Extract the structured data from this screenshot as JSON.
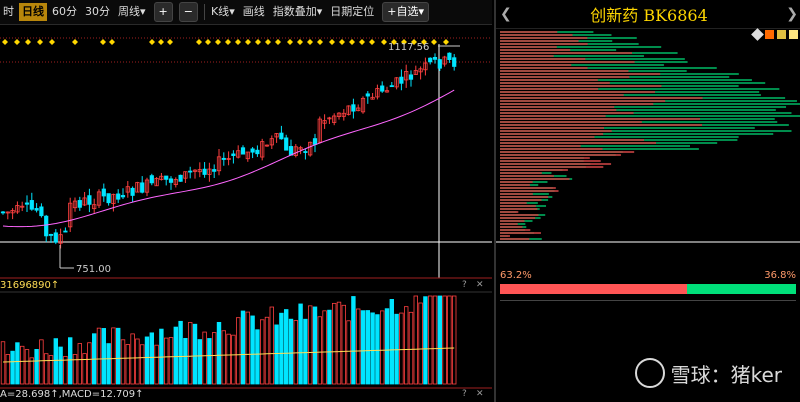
{
  "toolbar": {
    "items": [
      "时",
      "日线",
      "60分",
      "30分",
      "周线"
    ],
    "active_index": 1,
    "period_dropdown_caret": "▾",
    "plus": "+",
    "minus": "−",
    "kline": "K线",
    "draw": "画线",
    "indicator": "指数叠加",
    "date_locate": "日期定位",
    "watchlist": "+自选"
  },
  "panel": {
    "title": "创新药",
    "code": "BK6864",
    "nav_left": "❮",
    "nav_right": "❯",
    "pct_left": "63.2%",
    "pct_right": "36.8%",
    "buy_ratio": 0.632
  },
  "chart": {
    "high_label": "1117.56",
    "low_label": "751.00"
  },
  "volume": {
    "label": "31696890↑"
  },
  "macd": {
    "label": "A=28.698↑,MACD=12.709↑"
  },
  "watermark": {
    "text": "雪球：猪ker"
  },
  "colors": {
    "up": "#ff4040",
    "down": "#00e5ff",
    "ma": "#ff66ff",
    "accent": "#ffd700",
    "buy": "#ff5555",
    "sell": "#00e07a"
  },
  "chart_data": {
    "type": "candlestick",
    "low_marker": 751.0,
    "high_marker": 1117.56
  }
}
